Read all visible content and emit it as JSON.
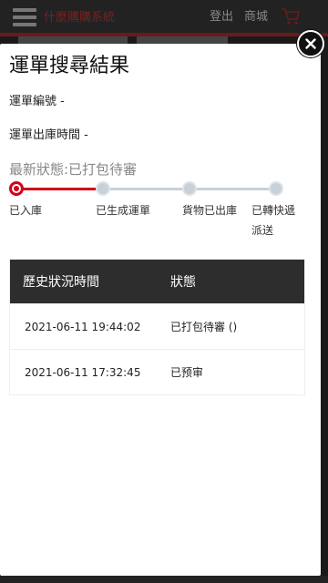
{
  "background": {
    "brand": "什麼購購系統",
    "logout": "登出",
    "shop": "商城"
  },
  "modal": {
    "title": "運單搜尋結果",
    "waybill_label": "運單編號 -",
    "outbound_time_label": "運單出庫時間 -",
    "latest_status": "最新狀態:已打包待審",
    "steps": [
      {
        "label": "已入庫",
        "active": true
      },
      {
        "label": "已生成運單",
        "active": false
      },
      {
        "label": "貨物已出庫",
        "active": false
      },
      {
        "label": "已轉快遞派送",
        "active": false
      }
    ],
    "history": {
      "headers": [
        "歷史狀況時間",
        "狀態"
      ],
      "rows": [
        {
          "time": "2021-06-11 19:44:02",
          "status": "已打包待審 ()"
        },
        {
          "time": "2021-06-11 17:32:45",
          "status": "已预审"
        }
      ]
    }
  },
  "colors": {
    "accent": "#d0021b",
    "inactive_step": "#c8d0d8",
    "table_header_bg": "#2d2d2d"
  },
  "icons": {
    "close": "close-icon",
    "menu": "hamburger-icon",
    "cart": "cart-icon"
  }
}
